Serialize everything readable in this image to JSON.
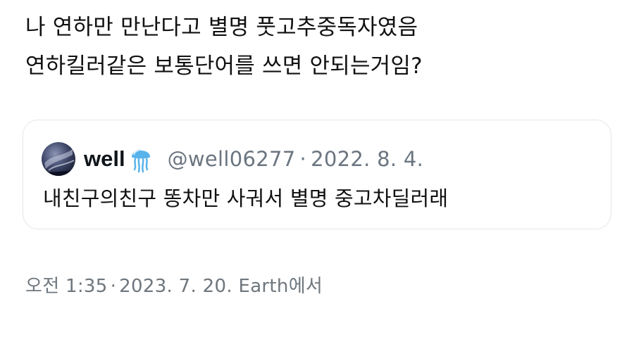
{
  "tweet": {
    "lines": [
      "나 연하만 만난다고 별명 풋고추중독자였음",
      "연하킬러같은 보통단어를 쓰면 안되는거임?"
    ],
    "time": "오전 1:35",
    "date": "2023. 7. 20.",
    "source": "Earth에서",
    "separator": "·"
  },
  "quote": {
    "display_name": "well",
    "handle": "@well06277",
    "separator": "·",
    "date": "2022. 8. 4.",
    "text": "내친구의친구 똥차만 사궈서 별명 중고차딜러래",
    "avatar_icon": "stormy-sky-avatar",
    "badge_icon": "jellyfish-icon"
  },
  "colors": {
    "text": "#111111",
    "muted": "#6b7580",
    "border": "#e3e6e9",
    "badge": "#4aa3df"
  }
}
